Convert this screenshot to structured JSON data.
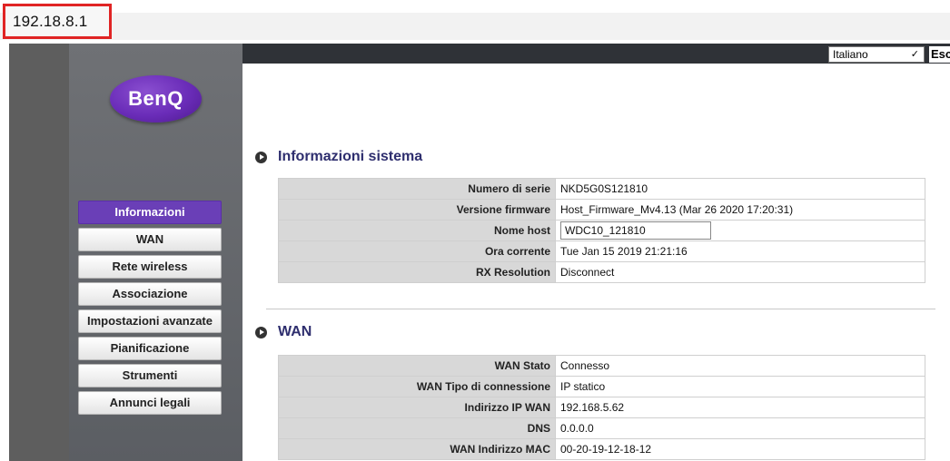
{
  "browser": {
    "url": "192.18.8.1"
  },
  "brand": {
    "logo_text": "BenQ",
    "logo_color": "#6a2cb8"
  },
  "header": {
    "language_selected": "Italiano",
    "exit_label": "Esc"
  },
  "sidebar": {
    "items": [
      {
        "label": "Informazioni",
        "active": true
      },
      {
        "label": "WAN"
      },
      {
        "label": "Rete wireless"
      },
      {
        "label": "Associazione"
      },
      {
        "label": "Impostazioni avanzate"
      },
      {
        "label": "Pianificazione"
      },
      {
        "label": "Strumenti"
      },
      {
        "label": "Annunci legali"
      }
    ]
  },
  "system_info": {
    "title": "Informazioni sistema",
    "rows": [
      {
        "label": "Numero di serie",
        "value": "NKD5G0S121810"
      },
      {
        "label": "Versione firmware",
        "value": "Host_Firmware_Mv4.13 (Mar 26 2020 17:20:31)"
      },
      {
        "label": "Nome host",
        "value": "WDC10_121810"
      },
      {
        "label": "Ora corrente",
        "value": "Tue Jan 15 2019 21:21:16"
      },
      {
        "label": "RX Resolution",
        "value": "Disconnect"
      }
    ]
  },
  "wan": {
    "title": "WAN",
    "rows": [
      {
        "label": "WAN Stato",
        "value": "Connesso"
      },
      {
        "label": "WAN Tipo di connessione",
        "value": "IP statico"
      },
      {
        "label": "Indirizzo IP WAN",
        "value": "192.168.5.62"
      },
      {
        "label": "DNS",
        "value": "0.0.0.0"
      },
      {
        "label": "WAN Indirizzo MAC",
        "value": "00-20-19-12-18-12"
      }
    ]
  },
  "colors": {
    "accent_active": "#6a3fb7",
    "topbar": "#2f3237",
    "section_title": "#2e2e6e",
    "url_highlight": "#e02424"
  }
}
